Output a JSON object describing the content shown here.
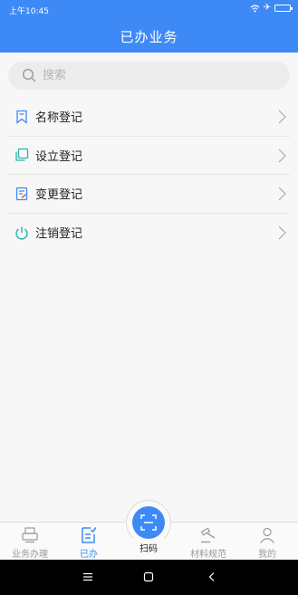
{
  "status_bar": {
    "time": "上午10:45"
  },
  "header": {
    "title": "已办业务"
  },
  "search": {
    "placeholder": "搜索",
    "value": ""
  },
  "list": [
    {
      "label": "名称登记",
      "icon": "bookmark-icon"
    },
    {
      "label": "设立登记",
      "icon": "copy-icon"
    },
    {
      "label": "变更登记",
      "icon": "document-edit-icon"
    },
    {
      "label": "注销登记",
      "icon": "power-icon"
    }
  ],
  "tabbar": {
    "items": [
      {
        "label": "业务办理",
        "icon": "printer-icon",
        "active": false
      },
      {
        "label": "已办",
        "icon": "checklist-icon",
        "active": true
      },
      {
        "label": "扫码",
        "icon": "scan-icon",
        "active": false
      },
      {
        "label": "材料规范",
        "icon": "gavel-icon",
        "active": false
      },
      {
        "label": "我的",
        "icon": "user-icon",
        "active": false
      }
    ]
  },
  "colors": {
    "primary": "#3d8af7",
    "icon_teal": "#2bb5a8",
    "icon_green": "#2fb56a",
    "background": "#f7f7f7"
  }
}
